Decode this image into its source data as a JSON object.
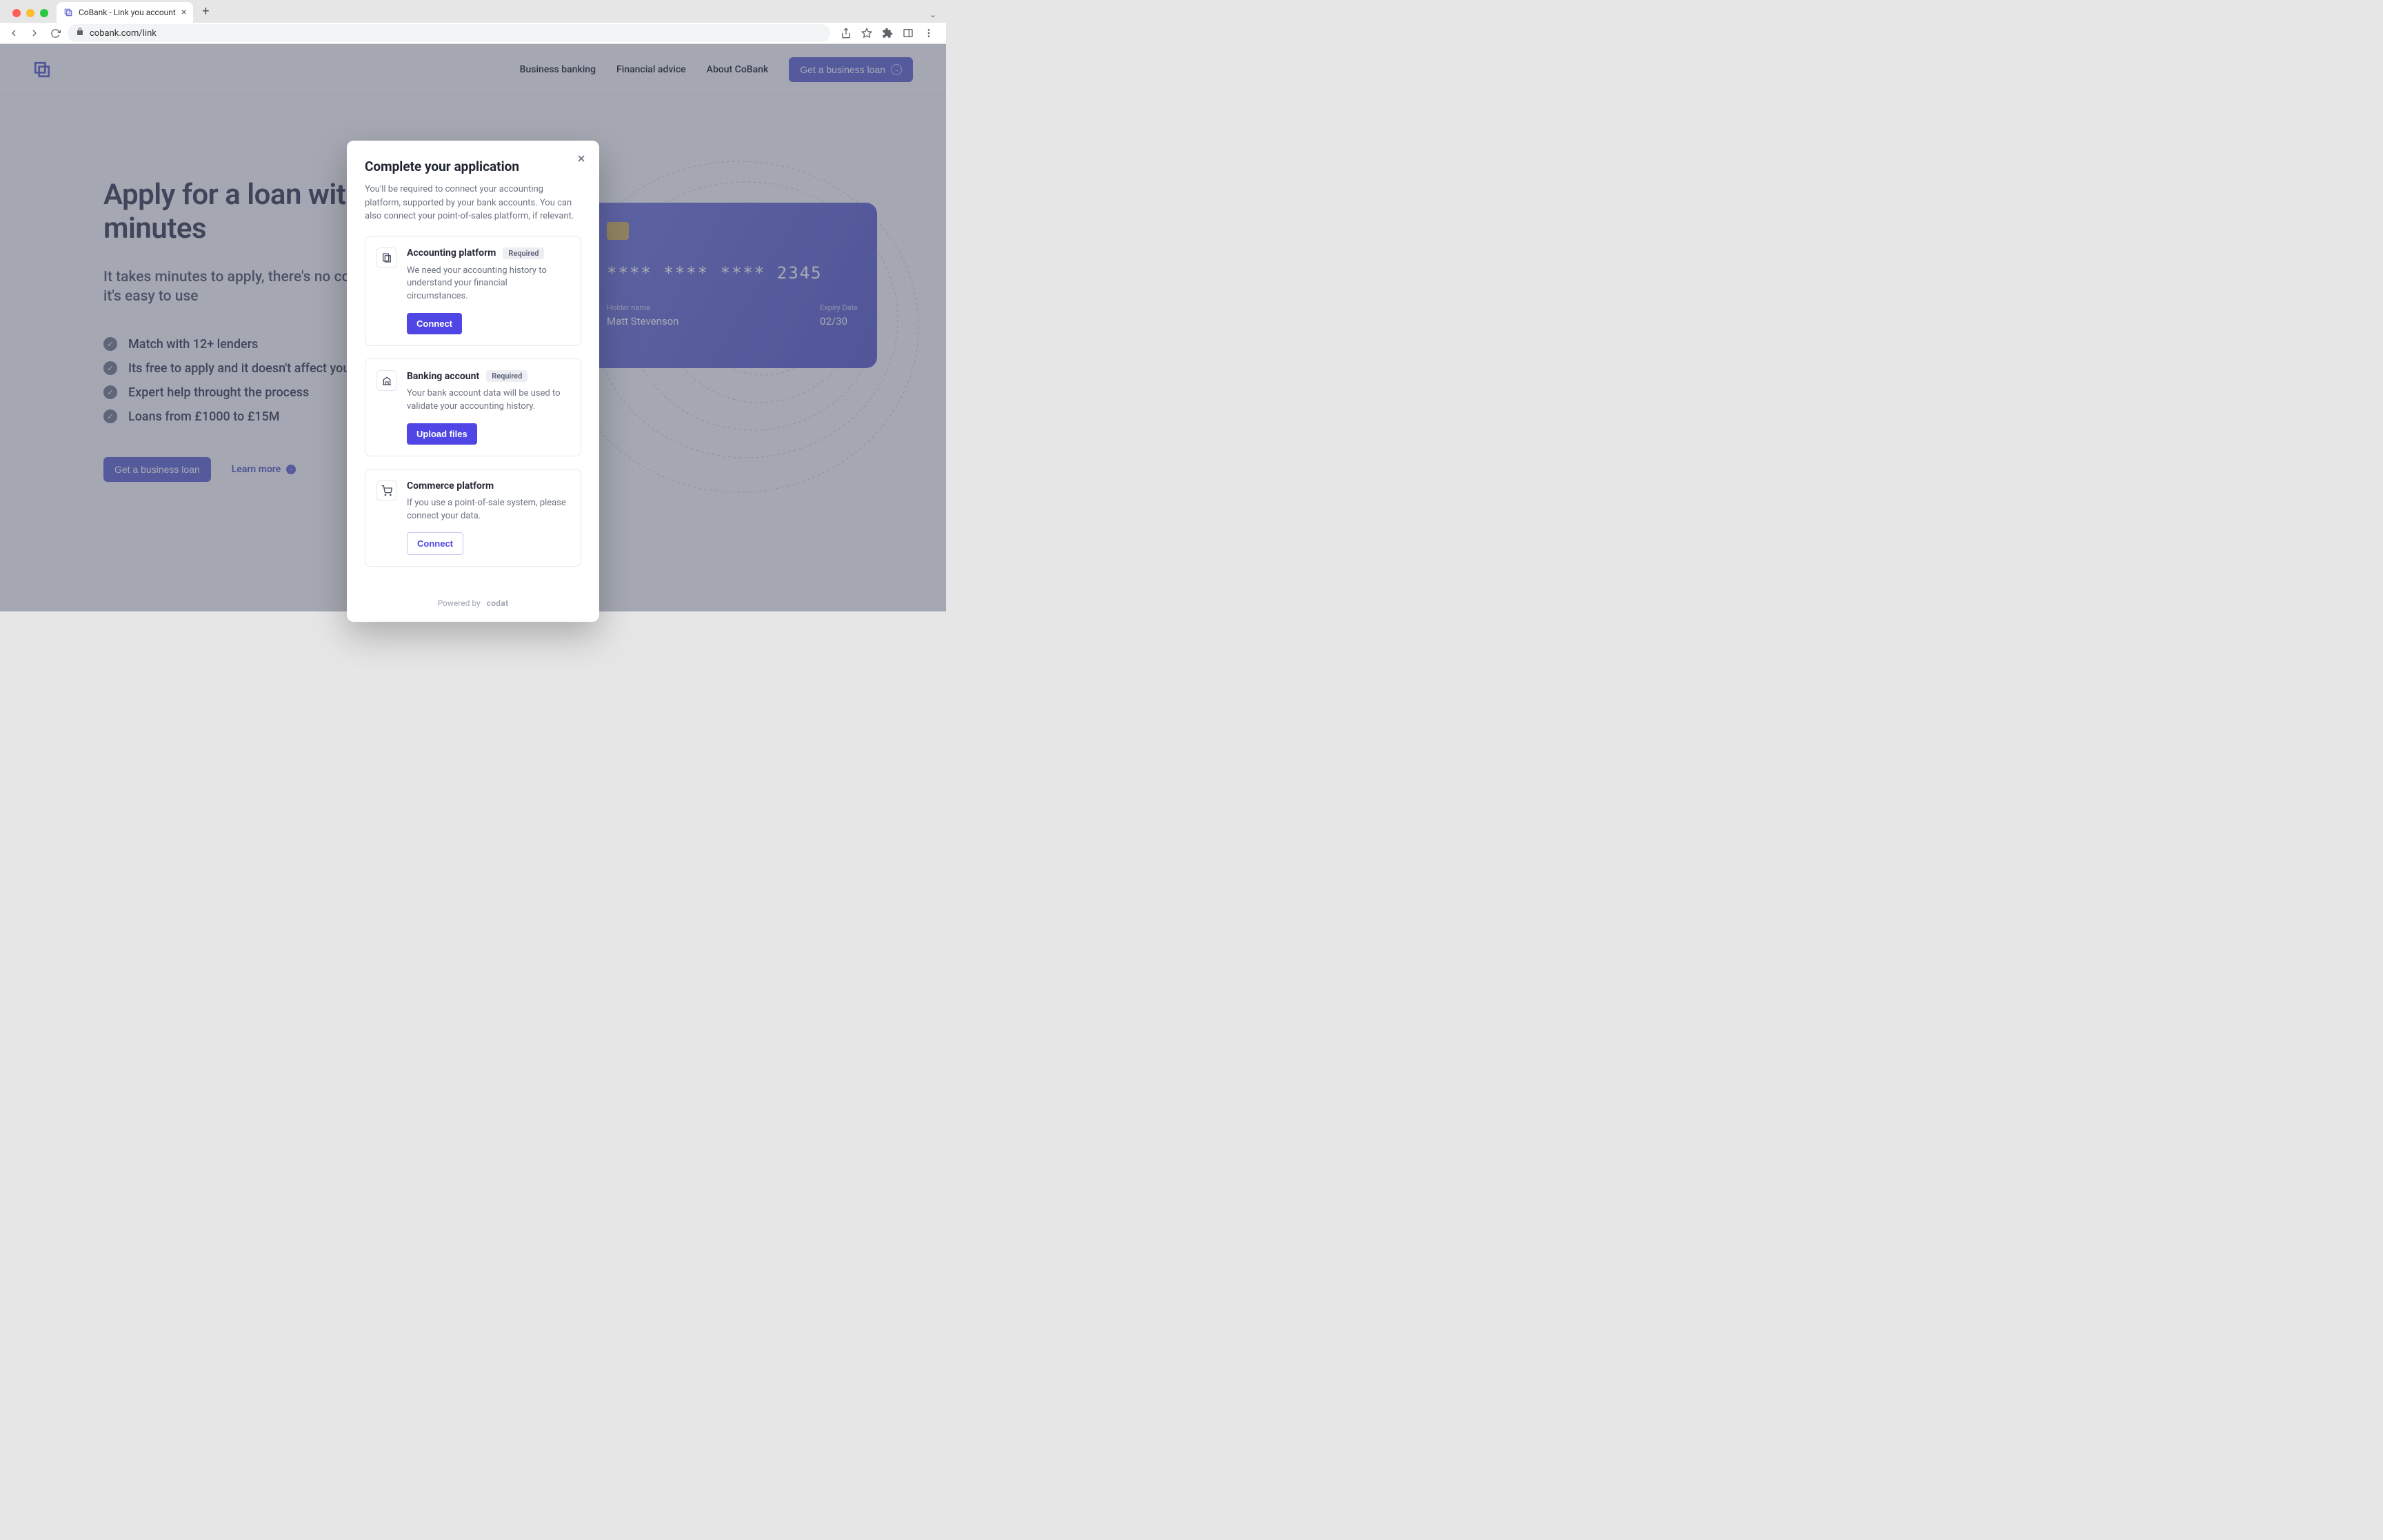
{
  "browser": {
    "tab_title": "CoBank - Link you account",
    "url": "cobank.com/link"
  },
  "header": {
    "nav": {
      "business_banking": "Business banking",
      "financial_advice": "Financial advice",
      "about": "About CoBank"
    },
    "cta": "Get a business loan"
  },
  "hero": {
    "title": "Apply for a loan within minutes",
    "subtitle": "It takes minutes to apply, there's no cost involved and it's easy to use",
    "bullets": [
      "Match with 12+ lenders",
      "Its free to apply and it doesn't affect your credit score",
      "Expert help throught the process",
      "Loans from £1000 to £15M"
    ],
    "cta": "Get a business loan",
    "learn_more": "Learn more"
  },
  "card": {
    "number": "**** **** **** 2345",
    "holder_label": "Holder name",
    "holder_name": "Matt Stevenson",
    "expiry_label": "Expiry Date",
    "expiry": "02/30"
  },
  "modal": {
    "title": "Complete your application",
    "description": "You'll be required to connect your accounting platform, supported by your bank accounts. You can also connect your point-of-sales platform, if relevant.",
    "required_badge": "Required",
    "steps": {
      "accounting": {
        "title": "Accounting platform",
        "desc": "We need your accounting history to understand your financial circumstances.",
        "button": "Connect"
      },
      "banking": {
        "title": "Banking account",
        "desc": "Your bank account data will be used to validate your accounting history.",
        "button": "Upload files"
      },
      "commerce": {
        "title": "Commerce platform",
        "desc": "If you use a point-of-sale system, please connect your data.",
        "button": "Connect"
      }
    },
    "powered_by_prefix": "Powered by",
    "powered_by_brand": "codat"
  }
}
